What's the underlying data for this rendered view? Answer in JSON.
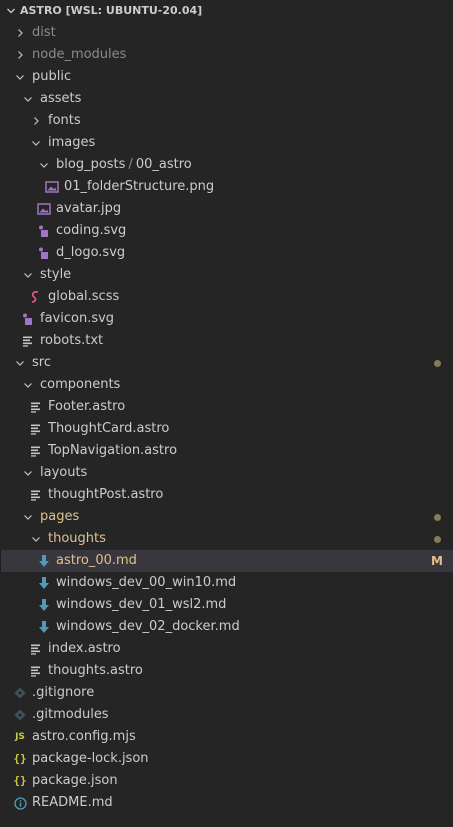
{
  "explorer": {
    "title": "ASTRO [WSL: UBUNTU-20.04]",
    "items": [
      {
        "depth": 0,
        "kind": "folder-closed",
        "label": "dist",
        "dim": true,
        "icon": "chevron-right-icon"
      },
      {
        "depth": 0,
        "kind": "folder-closed",
        "label": "node_modules",
        "dim": true,
        "icon": "chevron-right-icon"
      },
      {
        "depth": 0,
        "kind": "folder-open",
        "label": "public",
        "icon": "chevron-down-icon"
      },
      {
        "depth": 1,
        "kind": "folder-open",
        "label": "assets",
        "icon": "chevron-down-icon"
      },
      {
        "depth": 2,
        "kind": "folder-closed",
        "label": "fonts",
        "icon": "chevron-right-icon"
      },
      {
        "depth": 2,
        "kind": "folder-open",
        "label": "images",
        "icon": "chevron-down-icon"
      },
      {
        "depth": 3,
        "kind": "folder-open-compact",
        "label": "blog_posts",
        "label2": "00_astro",
        "icon": "chevron-down-icon"
      },
      {
        "depth": 4,
        "kind": "file",
        "label": "01_folderStructure.png",
        "icon": "image-file-icon"
      },
      {
        "depth": 3,
        "kind": "file",
        "label": "avatar.jpg",
        "icon": "image-file-icon"
      },
      {
        "depth": 3,
        "kind": "file",
        "label": "coding.svg",
        "icon": "svg-file-icon"
      },
      {
        "depth": 3,
        "kind": "file",
        "label": "d_logo.svg",
        "icon": "svg-file-icon"
      },
      {
        "depth": 1,
        "kind": "folder-open",
        "label": "style",
        "icon": "chevron-down-icon"
      },
      {
        "depth": 2,
        "kind": "file",
        "label": "global.scss",
        "icon": "scss-file-icon"
      },
      {
        "depth": 1,
        "kind": "file",
        "label": "favicon.svg",
        "icon": "svg-file-icon"
      },
      {
        "depth": 1,
        "kind": "file",
        "label": "robots.txt",
        "icon": "text-file-icon"
      },
      {
        "depth": 0,
        "kind": "folder-open",
        "label": "src",
        "icon": "chevron-down-icon",
        "status": "dot"
      },
      {
        "depth": 1,
        "kind": "folder-open",
        "label": "components",
        "icon": "chevron-down-icon"
      },
      {
        "depth": 2,
        "kind": "file",
        "label": "Footer.astro",
        "icon": "text-file-icon"
      },
      {
        "depth": 2,
        "kind": "file",
        "label": "ThoughtCard.astro",
        "icon": "text-file-icon"
      },
      {
        "depth": 2,
        "kind": "file",
        "label": "TopNavigation.astro",
        "icon": "text-file-icon"
      },
      {
        "depth": 1,
        "kind": "folder-open",
        "label": "layouts",
        "icon": "chevron-down-icon"
      },
      {
        "depth": 2,
        "kind": "file",
        "label": "thoughtPost.astro",
        "icon": "text-file-icon"
      },
      {
        "depth": 1,
        "kind": "folder-open",
        "label": "pages",
        "icon": "chevron-down-icon",
        "modified": true,
        "status": "dot"
      },
      {
        "depth": 2,
        "kind": "folder-open",
        "label": "thoughts",
        "icon": "chevron-down-icon",
        "modified": true,
        "status": "dot"
      },
      {
        "depth": 3,
        "kind": "file",
        "label": "astro_00.md",
        "icon": "markdown-file-icon",
        "modified": true,
        "status": "M",
        "selected": true
      },
      {
        "depth": 3,
        "kind": "file",
        "label": "windows_dev_00_win10.md",
        "icon": "markdown-file-icon"
      },
      {
        "depth": 3,
        "kind": "file",
        "label": "windows_dev_01_wsl2.md",
        "icon": "markdown-file-icon"
      },
      {
        "depth": 3,
        "kind": "file",
        "label": "windows_dev_02_docker.md",
        "icon": "markdown-file-icon"
      },
      {
        "depth": 2,
        "kind": "file",
        "label": "index.astro",
        "icon": "text-file-icon"
      },
      {
        "depth": 2,
        "kind": "file",
        "label": "thoughts.astro",
        "icon": "text-file-icon"
      },
      {
        "depth": 0,
        "kind": "file",
        "label": ".gitignore",
        "icon": "git-file-icon"
      },
      {
        "depth": 0,
        "kind": "file",
        "label": ".gitmodules",
        "icon": "git-file-icon"
      },
      {
        "depth": 0,
        "kind": "file",
        "label": "astro.config.mjs",
        "icon": "js-file-icon"
      },
      {
        "depth": 0,
        "kind": "file",
        "label": "package-lock.json",
        "icon": "json-file-icon"
      },
      {
        "depth": 0,
        "kind": "file",
        "label": "package.json",
        "icon": "json-file-icon"
      },
      {
        "depth": 0,
        "kind": "file",
        "label": "README.md",
        "icon": "info-file-icon"
      }
    ]
  },
  "colors": {
    "background": "#252526",
    "selected": "#37373d",
    "text": "#cccccc",
    "dim": "#8b8b8b",
    "modified": "#e2c08d",
    "markdown": "#519aba",
    "image": "#a074c4",
    "scss": "#f55385",
    "json": "#cbcb41",
    "git": "#41535b"
  }
}
